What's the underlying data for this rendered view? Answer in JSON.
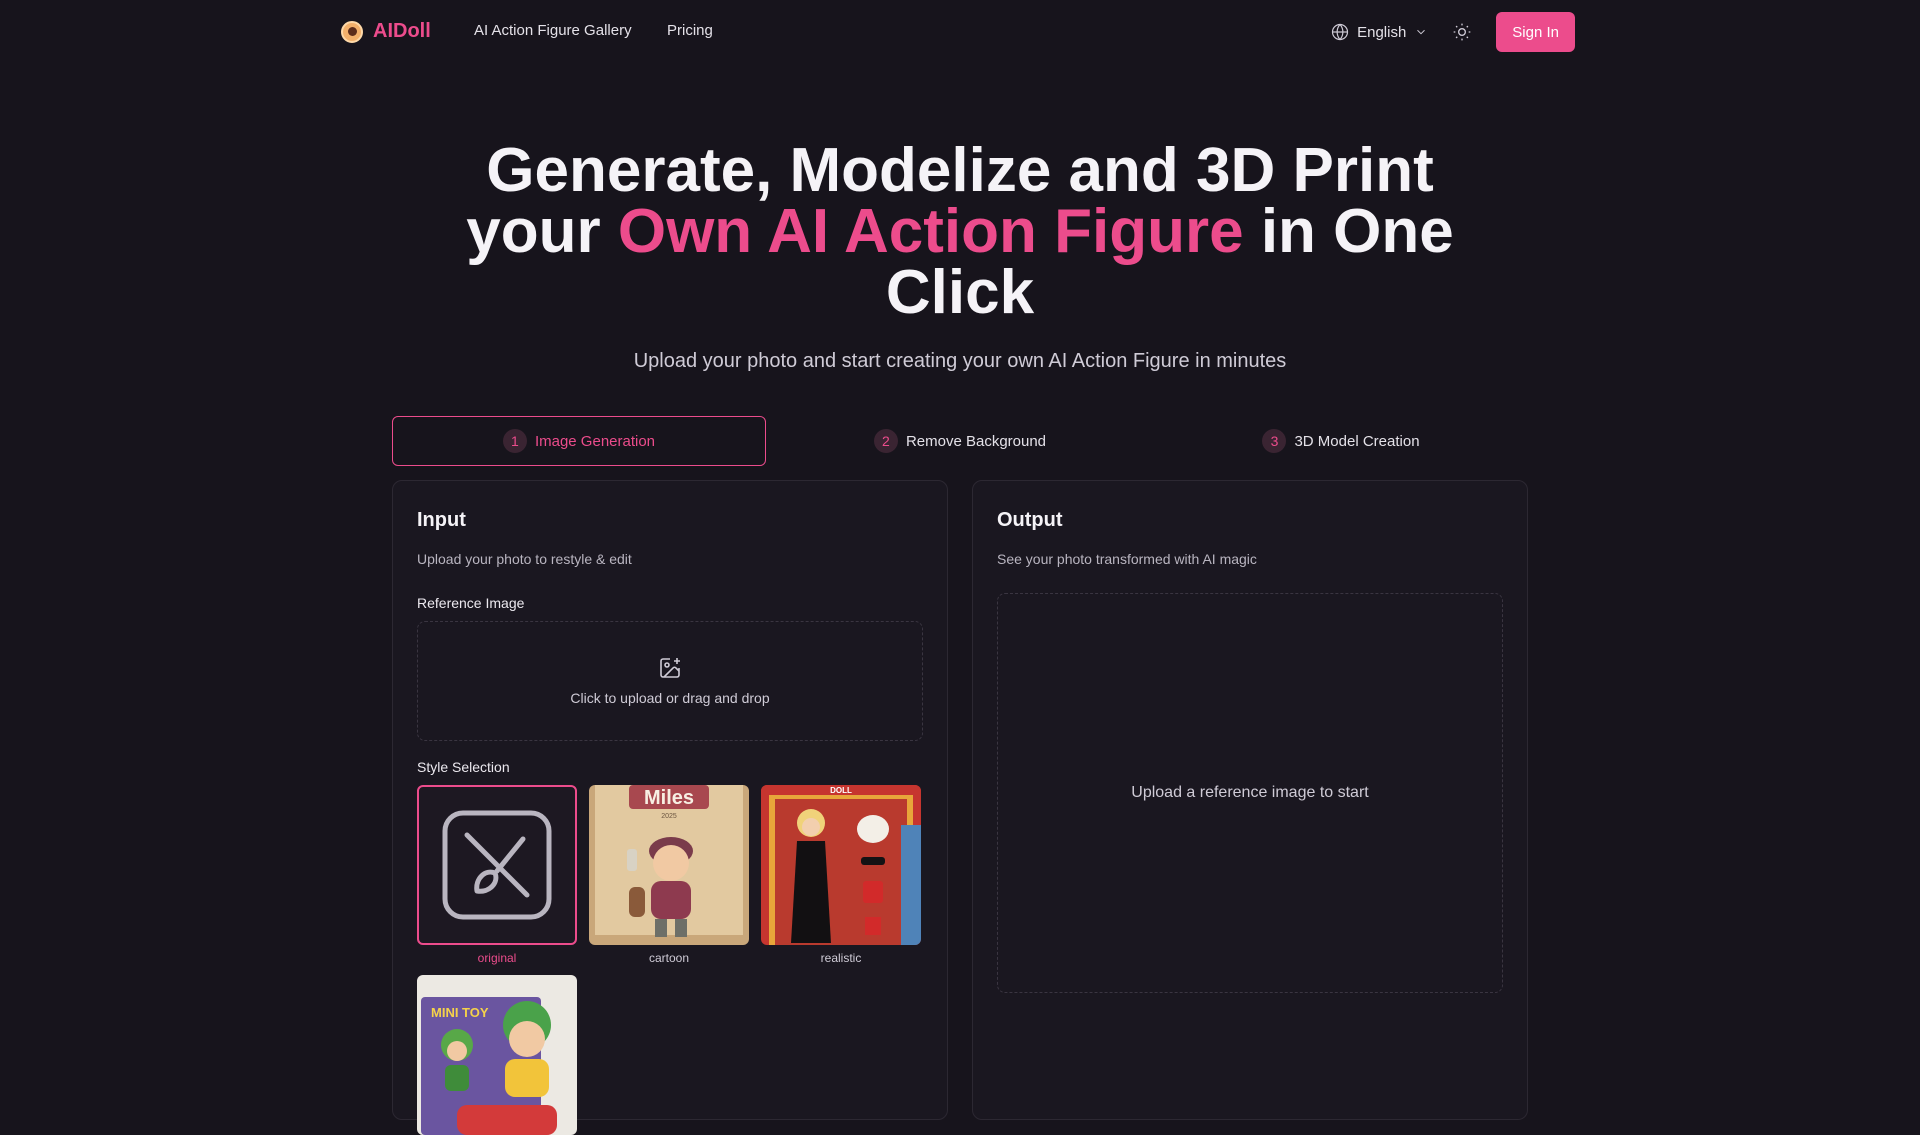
{
  "nav": {
    "brand": "AIDoll",
    "links": [
      "AI Action Figure Gallery",
      "Pricing"
    ],
    "language": "English",
    "sign_in": "Sign In"
  },
  "hero": {
    "line1": "Generate, Modelize and 3D Print",
    "line2_pre": "your ",
    "line2_accent": "Own AI Action Figure",
    "line2_post": " in One",
    "line3": "Click",
    "subtitle": "Upload your photo and start creating your own AI Action Figure in minutes"
  },
  "steps": [
    {
      "num": "1",
      "label": "Image Generation",
      "active": true
    },
    {
      "num": "2",
      "label": "Remove Background",
      "active": false
    },
    {
      "num": "3",
      "label": "3D Model Creation",
      "active": false
    }
  ],
  "input_card": {
    "title": "Input",
    "description": "Upload your photo to restyle & edit",
    "reference_label": "Reference Image",
    "upload_text": "Click to upload or drag and drop",
    "style_label": "Style Selection",
    "styles": [
      {
        "label": "original",
        "selected": true
      },
      {
        "label": "cartoon",
        "selected": false,
        "thumb_text": "Miles",
        "thumb_sub": "2025"
      },
      {
        "label": "realistic",
        "selected": false,
        "thumb_text": "DOLL"
      },
      {
        "label": "",
        "selected": false,
        "thumb_text": "MINI TOY"
      }
    ]
  },
  "output_card": {
    "title": "Output",
    "description": "See your photo transformed with AI magic",
    "placeholder": "Upload a reference image to start"
  },
  "colors": {
    "accent": "#ec4c8c",
    "background": "#17141c",
    "card_bg": "#1a1720"
  },
  "icons": [
    "globe-icon",
    "chevron-down-icon",
    "sun-icon",
    "image-plus-icon",
    "no-brush-icon"
  ]
}
